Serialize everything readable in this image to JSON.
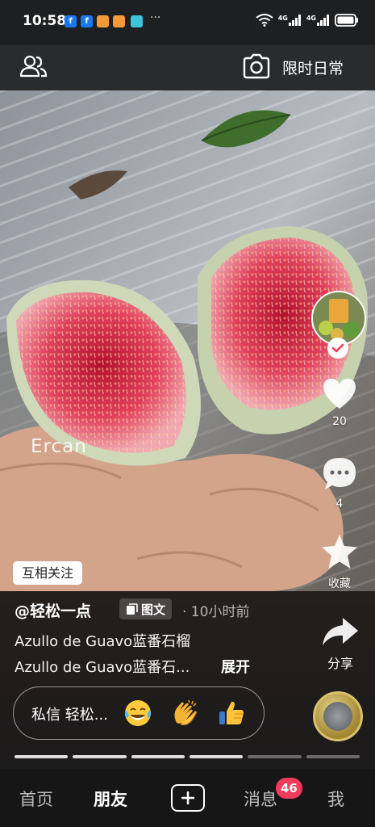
{
  "status_bar": {
    "time": "10:58",
    "more": "···",
    "network_1": "4G",
    "network_2": "4G",
    "notification_icons": [
      {
        "name": "facebook-icon",
        "glyph": "f",
        "color": "#1877f2"
      },
      {
        "name": "facebook-icon",
        "glyph": "f",
        "color": "#1877f2"
      },
      {
        "name": "chat-app-icon",
        "glyph": "",
        "color": "#f29b38"
      },
      {
        "name": "chat-app-icon",
        "glyph": "",
        "color": "#f29b38"
      },
      {
        "name": "book-app-icon",
        "glyph": "",
        "color": "#3ec3d8"
      }
    ]
  },
  "header": {
    "moment_label": "限时日常"
  },
  "media": {
    "watermark": "Ercan",
    "follow_tag": "互相关注"
  },
  "actions": {
    "like_count": "20",
    "comment_count": "4",
    "favorite_label": "收藏",
    "share_label": "分享"
  },
  "post": {
    "author": "@轻松一点",
    "type_label": "图文",
    "posted_time": "· 10小时前",
    "caption_line1": "Azullo de Guavo蓝番石榴",
    "caption_line2": "Azullo de Guavo蓝番石...",
    "expand_label": "展开"
  },
  "message_bar": {
    "label": "私信 轻松...",
    "emojis": [
      "tears-of-joy-emoji",
      "clapping-hands-emoji",
      "thumbs-up-emoji"
    ]
  },
  "progress": {
    "segments": 6,
    "completed": 4
  },
  "tabs": {
    "home": "首页",
    "friends": "朋友",
    "messages": "消息",
    "me": "我",
    "messages_badge": "46"
  },
  "colors": {
    "accent_badge": "#f23a5a",
    "like_heart": "#ffffff"
  }
}
